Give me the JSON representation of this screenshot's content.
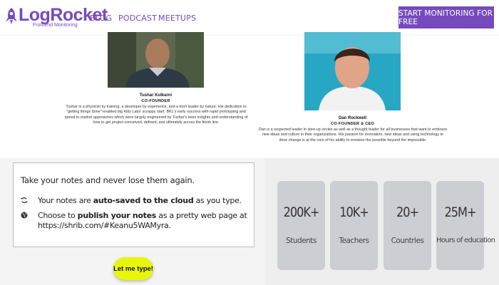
{
  "header": {
    "logo_text": "LogRocket",
    "logo_subtitle": "Frontend Monitoring",
    "nav": [
      "BLOG",
      "PODCAST",
      "MEETUPS"
    ],
    "cta_label": "START MONITORING FOR FREE",
    "brand_color": "#764abc"
  },
  "founders": [
    {
      "name": "Tushar Kulkarni",
      "role": "CO-FOUNDER",
      "bio": "Tushar is a physicist by training, a developer by experience, and a born leader by nature. His dedication to \"getting things done\" enabled big Kitty Labs' scrappy start. BKL's early success with rapid prototyping and speed to market approaches which were largely engineered by Tushar's keen insights and understanding of how to get project conceived, defined, and ultimately across the finish line."
    },
    {
      "name": "Dan Rockwell",
      "role": "CO-FOUNDER & CEO",
      "bio": "Dan is a respected leader in start-up circles as well as a thought leader for all businesses that want to embrace new ideas and culture in their organizations. His passion for innovation, new ideas and using technology to drive change is at the core of his ability to envision the possible beyond the impossible."
    }
  ],
  "notes": {
    "title": "Take your notes and never lose them again.",
    "item1_prefix": "Your notes are ",
    "item1_bold": "auto-saved to the cloud",
    "item1_suffix": " as you type.",
    "item2_prefix": "Choose to ",
    "item2_bold": "publish your notes",
    "item2_suffix": " as a pretty web page at",
    "item2_link": "https://shrib.com/#Keanu5WAMyra.",
    "button_label": "Let me type!",
    "icons": [
      "refresh-icon",
      "globe-icon"
    ]
  },
  "stats": [
    {
      "value": "200K+",
      "label": "Students"
    },
    {
      "value": "10K+",
      "label": "Teachers"
    },
    {
      "value": "20+",
      "label": "Countries"
    },
    {
      "value": "25M+",
      "label": "Hours of education"
    }
  ]
}
